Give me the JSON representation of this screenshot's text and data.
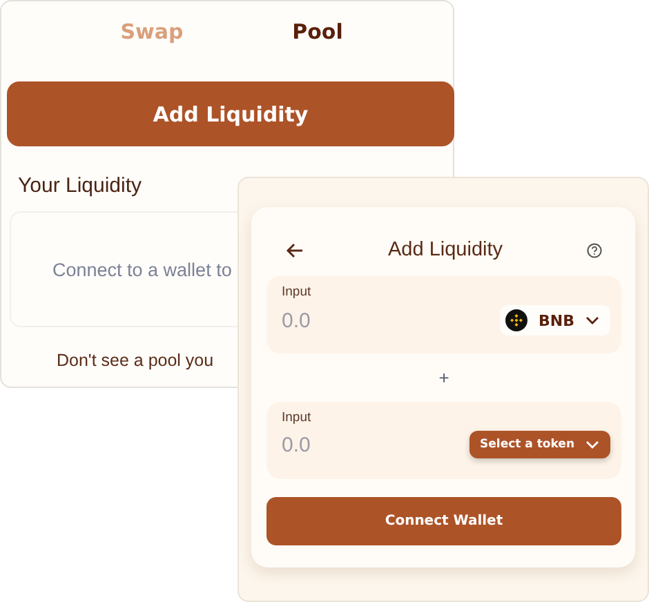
{
  "pool_panel": {
    "tabs": [
      {
        "label": "Swap",
        "selected": false
      },
      {
        "label": "Pool",
        "selected": true
      }
    ],
    "add_button": "Add Liquidity",
    "section_title": "Your Liquidity",
    "empty_message": "Connect to a wallet to",
    "footer_text": "Don't see a pool you"
  },
  "add_liquidity_dialog": {
    "title": "Add Liquidity",
    "inputs": [
      {
        "label": "Input",
        "placeholder": "0.0",
        "token": {
          "kind": "token",
          "symbol": "BNB"
        }
      },
      {
        "label": "Input",
        "placeholder": "0.0",
        "token": {
          "kind": "select",
          "label": "Select a token"
        }
      }
    ],
    "separator": "+",
    "connect_button": "Connect Wallet"
  }
}
